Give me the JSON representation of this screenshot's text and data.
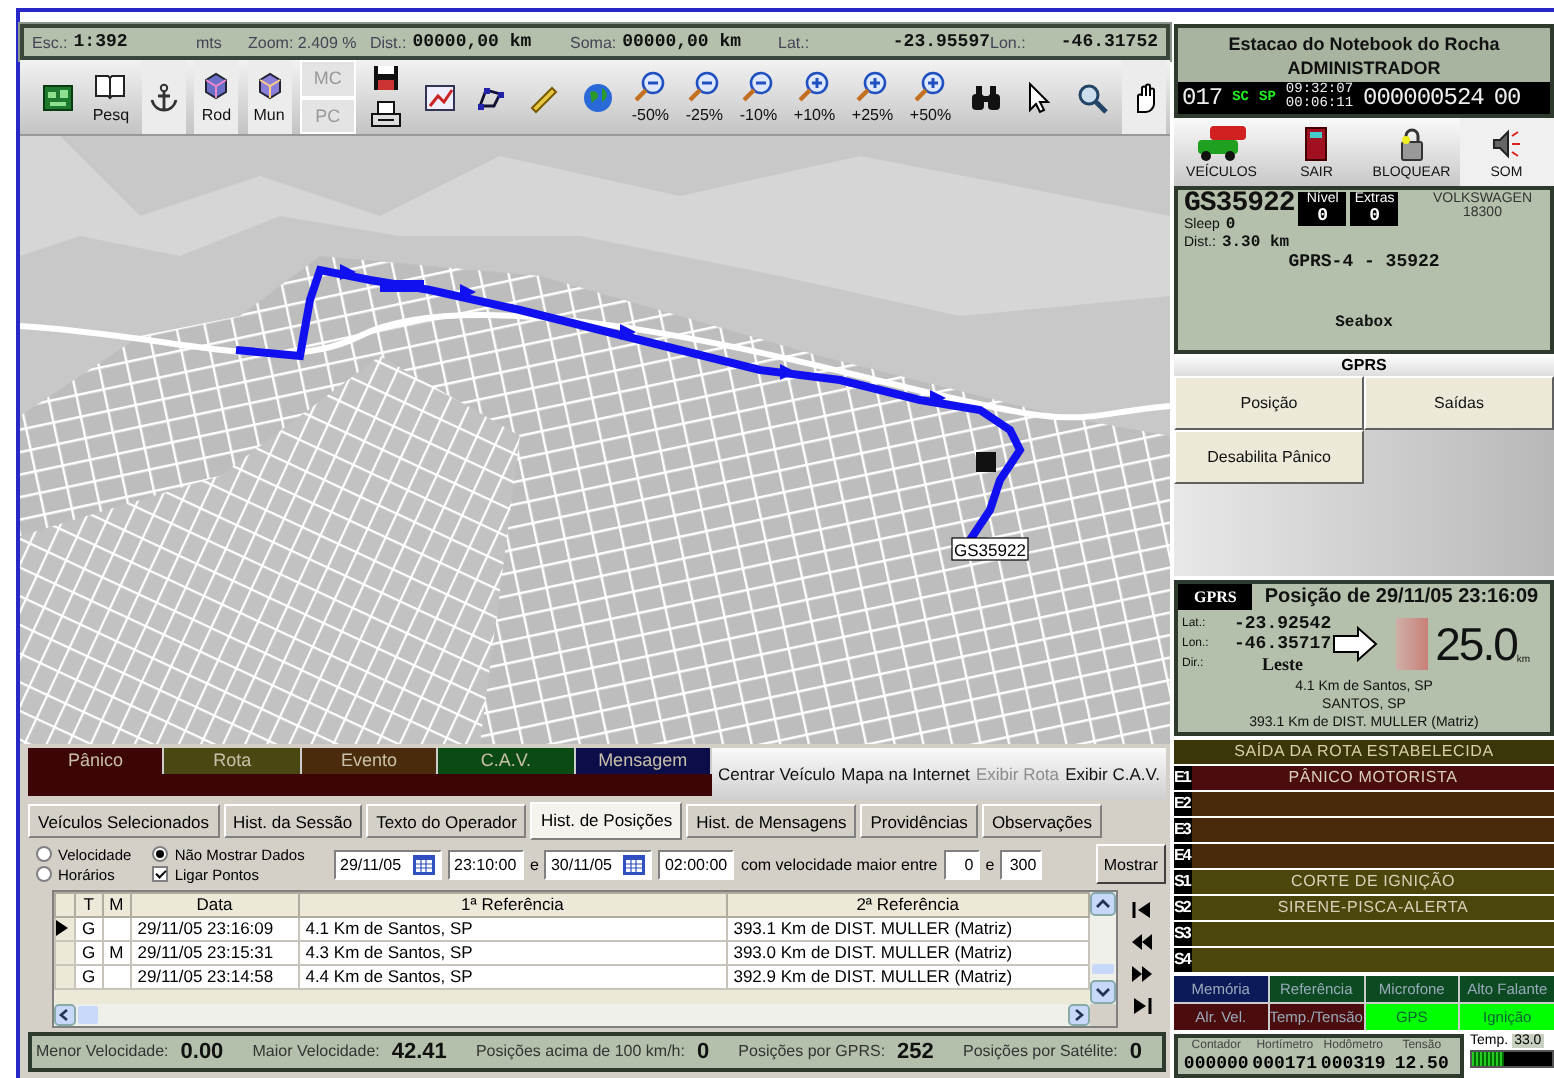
{
  "status_strip": [
    {
      "label": "Esc.:",
      "value": "1:392"
    },
    {
      "label": "mts"
    },
    {
      "label": "Zoom: 2.409 %"
    },
    {
      "label": "Dist.:",
      "value": "00000,00 km"
    },
    {
      "label": "Soma:",
      "value": "00000,00 km"
    },
    {
      "label": "Lat.:",
      "value": "-23.95597"
    },
    {
      "label": "Lon.:",
      "value": "-46.31752"
    }
  ],
  "toolbar": [
    {
      "items": [
        {
          "kind": "map",
          "pressed": false,
          "disabled": false
        }
      ]
    },
    {
      "items": [
        {
          "kind": "book",
          "label": "Pesq",
          "pressed": false,
          "disabled": false
        }
      ]
    },
    {
      "items": [
        {
          "kind": "anchor",
          "pressed": true,
          "disabled": false
        }
      ]
    },
    {
      "items": [
        {
          "kind": "roads",
          "label": "Rod",
          "pressed": true,
          "disabled": false
        }
      ]
    },
    {
      "items": [
        {
          "kind": "cities",
          "label": "Mun",
          "pressed": true,
          "disabled": false
        }
      ]
    },
    {
      "items": [
        {
          "kind": "text",
          "label": "MC",
          "pressed": false,
          "disabled": true
        },
        {
          "kind": "text",
          "label": "PC",
          "pressed": false,
          "disabled": true
        }
      ]
    },
    {
      "items": [
        {
          "kind": "save",
          "pressed": false,
          "disabled": false
        },
        {
          "kind": "print",
          "pressed": false,
          "disabled": false
        }
      ]
    },
    {
      "items": [
        {
          "kind": "chart",
          "pressed": false,
          "disabled": false
        }
      ]
    },
    {
      "items": [
        {
          "kind": "polyline",
          "pressed": false,
          "disabled": false
        }
      ]
    },
    {
      "items": [
        {
          "kind": "ruler",
          "pressed": false,
          "disabled": false
        }
      ]
    },
    {
      "items": [
        {
          "kind": "globe",
          "pressed": false,
          "disabled": false
        }
      ]
    },
    {
      "items": [
        {
          "kind": "zoom_out",
          "label": "-50%",
          "pressed": false,
          "disabled": false
        }
      ]
    },
    {
      "items": [
        {
          "kind": "zoom_out",
          "label": "-25%",
          "pressed": false,
          "disabled": false
        }
      ]
    },
    {
      "items": [
        {
          "kind": "zoom_out",
          "label": "-10%",
          "pressed": false,
          "disabled": false
        }
      ]
    },
    {
      "items": [
        {
          "kind": "zoom_in",
          "label": "+10%",
          "pressed": false,
          "disabled": false
        }
      ]
    },
    {
      "items": [
        {
          "kind": "zoom_in",
          "label": "+25%",
          "pressed": false,
          "disabled": false
        }
      ]
    },
    {
      "items": [
        {
          "kind": "zoom_in",
          "label": "+50%",
          "pressed": false,
          "disabled": false
        }
      ]
    },
    {
      "items": [
        {
          "kind": "binoculars",
          "pressed": false,
          "disabled": false
        }
      ]
    },
    {
      "items": [
        {
          "kind": "pointer",
          "pressed": false,
          "disabled": false
        }
      ]
    },
    {
      "items": [
        {
          "kind": "magnifier",
          "pressed": false,
          "disabled": false
        }
      ]
    },
    {
      "items": [
        {
          "kind": "hand",
          "pressed": true,
          "disabled": false
        }
      ]
    }
  ],
  "map": {
    "vehicle_label": "GS35922"
  },
  "alerts": {
    "tabs": [
      {
        "label": "Pânico",
        "color": "#3c0606"
      },
      {
        "label": "Rota",
        "color": "#4a4812"
      },
      {
        "label": "Evento",
        "color": "#4a2c0c"
      },
      {
        "label": "C.A.V.",
        "color": "#0c4a14"
      },
      {
        "label": "Mensagem",
        "color": "#0c0e4a"
      }
    ],
    "links": [
      {
        "label": "Centrar Veículo",
        "disabled": false
      },
      {
        "label": "Mapa na Internet",
        "disabled": false
      },
      {
        "label": "Exibir Rota",
        "disabled": true
      },
      {
        "label": "Exibir C.A.V.",
        "disabled": false
      }
    ]
  },
  "tabs": [
    {
      "label": "Veículos Selecionados",
      "selected": false
    },
    {
      "label": "Hist. da Sessão",
      "selected": false
    },
    {
      "label": "Texto do Operador",
      "selected": false
    },
    {
      "label": "Hist. de Posições",
      "selected": true
    },
    {
      "label": "Hist. de Mensagens",
      "selected": false
    },
    {
      "label": "Providências",
      "selected": false
    },
    {
      "label": "Observações",
      "selected": false
    }
  ],
  "filter": {
    "options": [
      {
        "kind": "radio",
        "label": "Velocidade",
        "checked": false
      },
      {
        "kind": "radio",
        "label": "Horários",
        "checked": false
      },
      {
        "kind": "radio",
        "label": "Não Mostrar Dados",
        "checked": true
      },
      {
        "kind": "checkbox",
        "label": "Ligar Pontos",
        "checked": true
      }
    ],
    "date_from": "29/11/05",
    "time_from": "23:10:00",
    "and_1": "e",
    "date_to": "30/11/05",
    "time_to": "02:00:00",
    "speed_label": "com velocidade maior entre",
    "speed_min": "0",
    "and_2": "e",
    "speed_max": "300",
    "button": "Mostrar"
  },
  "table": {
    "columns": [
      "T",
      "M",
      "Data",
      "1ª Referência",
      "2ª Referência"
    ],
    "rows": [
      {
        "selected": true,
        "t": "G",
        "data": "29/11/05 23:16:09",
        "ref1": "4.1 Km de Santos, SP",
        "ref2": "393.1 Km de DIST. MULLER (Matriz)"
      },
      {
        "selected": false,
        "t": "G",
        "m": "M",
        "data": "29/11/05 23:15:31",
        "ref1": "4.3 Km de Santos, SP",
        "ref2": "393.0 Km de DIST. MULLER (Matriz)"
      },
      {
        "selected": false,
        "t": "G",
        "data": "29/11/05 23:14:58",
        "ref1": "4.4 Km de Santos, SP",
        "ref2": "392.9 Km de DIST. MULLER (Matriz)"
      }
    ]
  },
  "summary": [
    {
      "label": "Menor Velocidade:",
      "value": "0.00"
    },
    {
      "label": "Maior Velocidade:",
      "value": "42.41"
    },
    {
      "label": "Posições acima de 100 km/h:",
      "value": "0"
    },
    {
      "label": "Posições por GPRS:",
      "value": "252"
    },
    {
      "label": "Posições por Satélite:",
      "value": "0"
    }
  ],
  "station": {
    "name": "Estacao do Notebook do Rocha",
    "user": "ADMINISTRADOR",
    "count": "017",
    "tag_1": "SC",
    "tag_2": "SP",
    "time_1": "09:32:07",
    "time_2": "00:06:11",
    "counter": "000000524",
    "extra": "00"
  },
  "actions": [
    {
      "kind": "vehicles",
      "label": "VEÍCULOS",
      "selected": false
    },
    {
      "kind": "exit",
      "label": "SAIR",
      "selected": false
    },
    {
      "kind": "lock",
      "label": "BLOQUEAR",
      "selected": false
    },
    {
      "kind": "sound",
      "label": "SOM",
      "selected": true
    }
  ],
  "vehicle": {
    "id": "GS35922",
    "level_label": "Nível",
    "level_value": "0",
    "extras_label": "Extras",
    "extras_value": "0",
    "make": "VOLKSWAGEN",
    "code": "18300",
    "sleep_label": "Sleep",
    "sleep": "0",
    "dist_label": "Dist.:",
    "dist": "3.30 km",
    "device": "GPRS-4 - 35922",
    "group": "Seabox"
  },
  "gprs": {
    "title": "GPRS",
    "buttons": [
      "Posição",
      "Saídas",
      "Desabilita Pânico"
    ]
  },
  "position": {
    "source": "GPRS",
    "title": "Posição de 29/11/05 23:16:09",
    "lat_label": "Lat.:",
    "lat": "-23.92542",
    "lon_label": "Lon.:",
    "lon": "-46.35717",
    "dir_label": "Dir.:",
    "dir": "Leste",
    "speed": "25.0",
    "unit": "km",
    "address": [
      "4.1 Km de Santos, SP",
      "SANTOS, SP",
      "393.1 Km de DIST. MULLER (Matriz)"
    ]
  },
  "outputs": {
    "title": "SAÍDA DA ROTA ESTABELECIDA",
    "rows": [
      {
        "code": "E1",
        "label": "PÂNICO MOTORISTA",
        "color": "#4a0c0c"
      },
      {
        "code": "E2",
        "color": "#4a2a0c"
      },
      {
        "code": "E3",
        "color": "#4a2a0c"
      },
      {
        "code": "E4",
        "color": "#4a2a0c"
      },
      {
        "code": "S1",
        "label": "CORTE DE IGNIÇÃO",
        "color": "#4a460c"
      },
      {
        "code": "S2",
        "label": "SIRENE-PISCA-ALERTA",
        "color": "#4a460c"
      },
      {
        "code": "S3",
        "color": "#4a460c"
      },
      {
        "code": "S4",
        "color": "#4a460c"
      }
    ]
  },
  "indicators": [
    {
      "label": "Memória",
      "color": "#0c1a5a"
    },
    {
      "label": "Referência",
      "color": "#0c4a22"
    },
    {
      "label": "Microfone",
      "color": "#0c4a22"
    },
    {
      "label": "Alto Falante",
      "color": "#0c4a22"
    },
    {
      "label": "Alr. Vel.",
      "color": "#4a0c0c"
    },
    {
      "label": "Temp./Tensão",
      "color": "#4a0c0c"
    },
    {
      "label": "GPS",
      "color": "#00ff00"
    },
    {
      "label": "Ignição",
      "color": "#00ff00"
    }
  ],
  "counters": [
    {
      "label": "Contador",
      "value": "000000"
    },
    {
      "label": "Hortímetro",
      "value": "000171"
    },
    {
      "label": "Hodômetro",
      "value": "000319"
    },
    {
      "label": "Tensão",
      "value": "12.50"
    }
  ],
  "temperature": {
    "label": "Temp.",
    "value": "33.0",
    "level": 0.4
  }
}
